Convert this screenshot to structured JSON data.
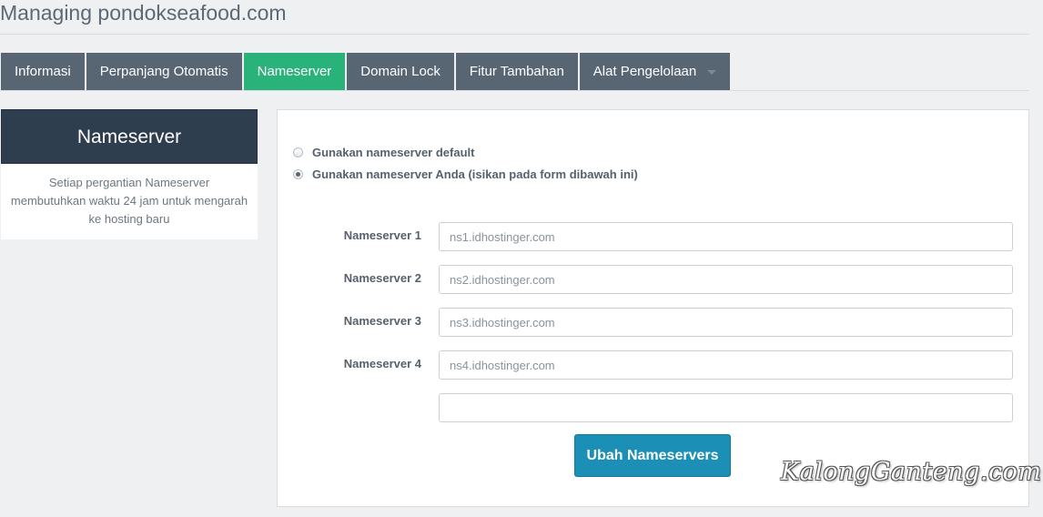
{
  "page": {
    "title": "Managing pondokseafood.com"
  },
  "tabs": [
    {
      "label": "Informasi",
      "active": false
    },
    {
      "label": "Perpanjang Otomatis",
      "active": false
    },
    {
      "label": "Nameserver",
      "active": true
    },
    {
      "label": "Domain Lock",
      "active": false
    },
    {
      "label": "Fitur Tambahan",
      "active": false
    },
    {
      "label": "Alat Pengelolaan",
      "active": false,
      "has_dropdown": true
    }
  ],
  "sidebar": {
    "title": "Nameserver",
    "description": "Setiap pergantian Nameserver membutuhkan waktu 24 jam untuk mengarah ke hosting baru"
  },
  "form": {
    "options": [
      {
        "label": "Gunakan nameserver default",
        "checked": false
      },
      {
        "label": "Gunakan nameserver Anda (isikan pada form dibawah ini)",
        "checked": true
      }
    ],
    "nameservers": [
      {
        "label": "Nameserver 1",
        "placeholder": "ns1.idhostinger.com"
      },
      {
        "label": "Nameserver 2",
        "placeholder": "ns2.idhostinger.com"
      },
      {
        "label": "Nameserver 3",
        "placeholder": "ns3.idhostinger.com"
      },
      {
        "label": "Nameserver 4",
        "placeholder": "ns4.idhostinger.com"
      },
      {
        "label": "",
        "placeholder": ""
      }
    ],
    "submit_label": "Ubah Nameservers"
  },
  "watermark": "KalongGanteng.com",
  "colors": {
    "tab_bg": "#586674",
    "tab_active": "#2ab27b",
    "sidebar_header": "#2f3e4f",
    "button": "#1b8fb5"
  }
}
